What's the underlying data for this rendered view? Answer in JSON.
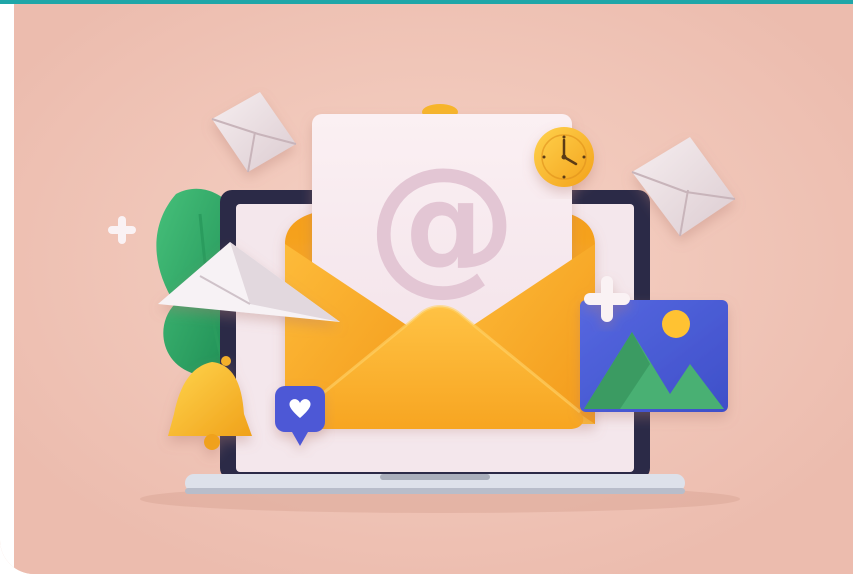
{
  "scene": {
    "background_color": "#f0c4b7",
    "accent_top_bar_color": "#1fa6a8",
    "envelope_color": "#f8a51d",
    "letter_symbol": "@",
    "icons": [
      "laptop-icon",
      "open-envelope-icon",
      "letter-paper-icon",
      "at-symbol-icon",
      "clock-icon",
      "paper-plane-icon",
      "bell-icon",
      "heart-chat-bubble-icon",
      "image-picture-icon",
      "closed-envelope-icon",
      "plus-icon",
      "leaf-plant-icon"
    ]
  }
}
